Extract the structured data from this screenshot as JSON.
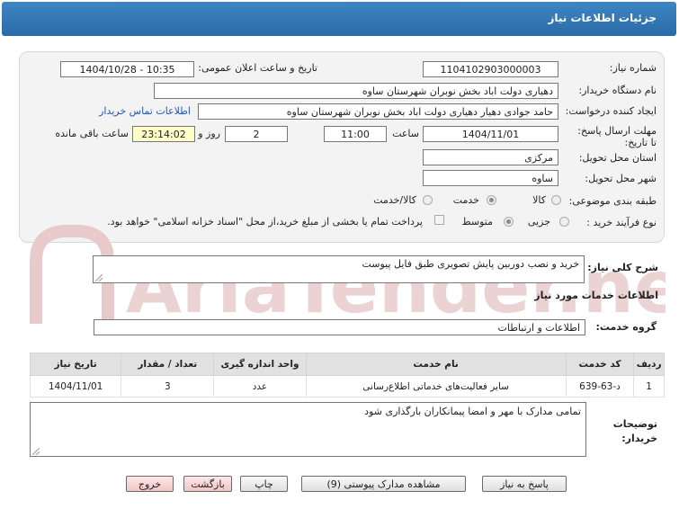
{
  "header": {
    "title": "جزئیات اطلاعات نیاز"
  },
  "need": {
    "number_label": "شماره نیاز:",
    "number": "1104102903000003",
    "announce_label": "تاریخ و ساعت اعلان عمومی:",
    "announce_value": "1404/10/28 - 10:35",
    "buyer_org_label": "نام دستگاه خریدار:",
    "buyer_org": "دهیاری دولت اباد بخش نوبران شهرستان ساوه",
    "creator_label": "ایجاد کننده درخواست:",
    "creator": "حامد جوادی دهیار دهیاری دولت اباد بخش نوبران شهرستان ساوه",
    "contact_link": "اطلاعات تماس خریدار",
    "deadline_label": "مهلت ارسال پاسخ: تا تاریخ:",
    "deadline_date": "1404/11/01",
    "time_label": "ساعت",
    "deadline_time": "11:00",
    "days_value": "2",
    "days_label": "روز و",
    "remaining_value": "23:14:02",
    "remaining_label": "ساعت باقی مانده",
    "province_label": "استان محل تحویل:",
    "province": "مرکزی",
    "city_label": "شهر محل تحویل:",
    "city": "ساوه",
    "category_label": "طبقه بندی موضوعی:",
    "category_options": [
      "کالا",
      "خدمت",
      "کالا/خدمت"
    ],
    "category_selected": "خدمت",
    "process_label": "نوع فرآیند خرید :",
    "process_options": [
      "جزیی",
      "متوسط"
    ],
    "process_selected": "متوسط",
    "payment_note": "پرداخت تمام یا بخشی از مبلغ خرید،از محل \"اسناد خزانه اسلامی\" خواهد بود."
  },
  "description": {
    "label": "شرح کلی نیاز:",
    "value": "خرید و نصب دوربین پایش تصویری  طبق فایل پیوست"
  },
  "services": {
    "section_title": "اطلاعات خدمات مورد نیاز",
    "group_label": "گروه خدمت:",
    "group_value": "اطلاعات و ارتباطات",
    "columns": [
      "ردیف",
      "کد خدمت",
      "نام خدمت",
      "واحد اندازه گیری",
      "تعداد / مقدار",
      "تاریخ نیاز"
    ],
    "rows": [
      [
        "1",
        "د-63-639",
        "سایر فعالیت‌های خدماتی اطلاع‌رسانی",
        "عدد",
        "3",
        "1404/11/01"
      ]
    ]
  },
  "buyer_notes": {
    "label": "توضیحات خریدار:",
    "value": "تمامی مدارک با مهر و امضا پیمانکاران بارگذاری شود"
  },
  "buttons": {
    "reply": "پاسخ به نیاز",
    "attachments": "مشاهده مدارک پیوستی (9)",
    "print": "چاپ",
    "back": "بازگشت",
    "exit": "خروج"
  },
  "colors": {
    "header": "#2f75b5",
    "link": "#1e58c2",
    "watermark": "#e8caca"
  },
  "watermark_text": "AriaTender.net"
}
